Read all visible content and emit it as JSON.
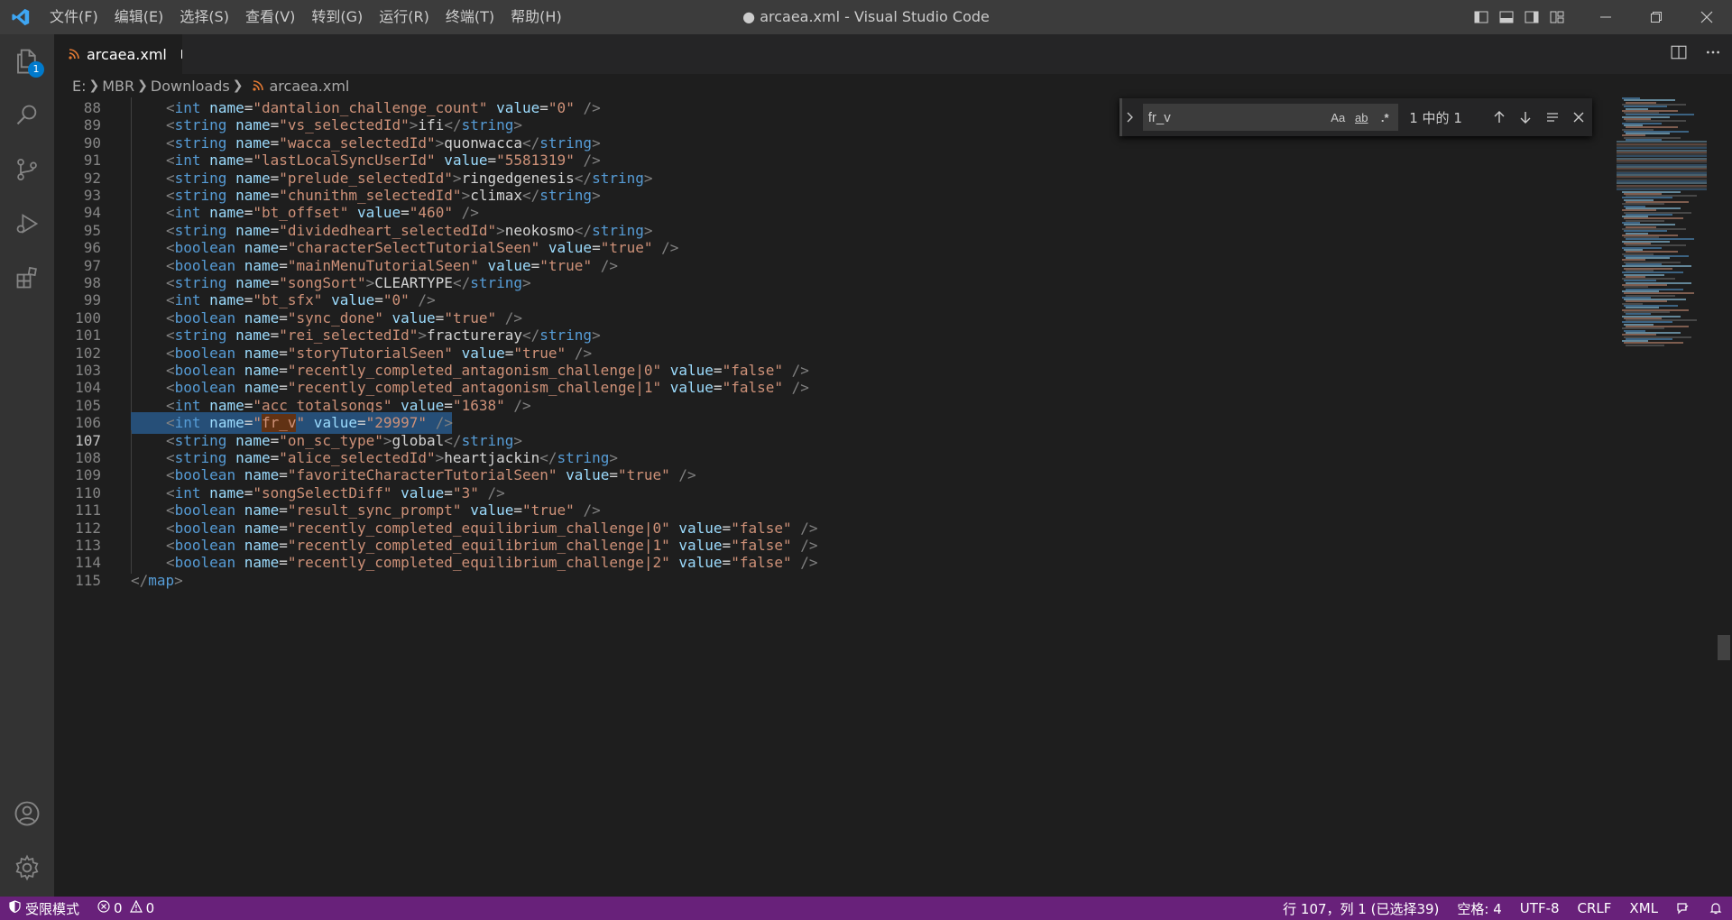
{
  "window": {
    "title": "● arcaea.xml - Visual Studio Code"
  },
  "menu": [
    "文件(F)",
    "编辑(E)",
    "选择(S)",
    "查看(V)",
    "转到(G)",
    "运行(R)",
    "终端(T)",
    "帮助(H)"
  ],
  "activity_bar": {
    "explorer_badge": "1"
  },
  "tab": {
    "label": "arcaea.xml",
    "dirty": true
  },
  "breadcrumb": [
    "E:",
    "MBR",
    "Downloads",
    "arcaea.xml"
  ],
  "find": {
    "query": "fr_v",
    "match_case_label": "Aa",
    "whole_word_label": "ab",
    "regex_label": ".*",
    "count": "1 中的 1"
  },
  "editor": {
    "current_line": 107,
    "selected_line": 106,
    "lines": [
      {
        "n": "88",
        "tag": "int",
        "name": "dantalion_challenge_count",
        "value": "0"
      },
      {
        "n": "89",
        "tag": "string",
        "name": "vs_selectedId",
        "text": "ifi"
      },
      {
        "n": "90",
        "tag": "string",
        "name": "wacca_selectedId",
        "text": "quonwacca"
      },
      {
        "n": "91",
        "tag": "int",
        "name": "lastLocalSyncUserId",
        "value": "5581319"
      },
      {
        "n": "92",
        "tag": "string",
        "name": "prelude_selectedId",
        "text": "ringedgenesis"
      },
      {
        "n": "93",
        "tag": "string",
        "name": "chunithm_selectedId",
        "text": "climax"
      },
      {
        "n": "94",
        "tag": "int",
        "name": "bt_offset",
        "value": "460"
      },
      {
        "n": "95",
        "tag": "string",
        "name": "dividedheart_selectedId",
        "text": "neokosmo"
      },
      {
        "n": "96",
        "tag": "boolean",
        "name": "characterSelectTutorialSeen",
        "value": "true"
      },
      {
        "n": "97",
        "tag": "boolean",
        "name": "mainMenuTutorialSeen",
        "value": "true"
      },
      {
        "n": "98",
        "tag": "string",
        "name": "songSort",
        "text": "CLEARTYPE"
      },
      {
        "n": "99",
        "tag": "int",
        "name": "bt_sfx",
        "value": "0"
      },
      {
        "n": "100",
        "tag": "boolean",
        "name": "sync_done",
        "value": "true"
      },
      {
        "n": "101",
        "tag": "string",
        "name": "rei_selectedId",
        "text": "fractureray"
      },
      {
        "n": "102",
        "tag": "boolean",
        "name": "storyTutorialSeen",
        "value": "true"
      },
      {
        "n": "103",
        "tag": "boolean",
        "name": "recently_completed_antagonism_challenge|0",
        "value": "false"
      },
      {
        "n": "104",
        "tag": "boolean",
        "name": "recently_completed_antagonism_challenge|1",
        "value": "false"
      },
      {
        "n": "105",
        "tag": "int",
        "name": "acc_totalsongs",
        "value": "1638"
      },
      {
        "n": "106",
        "tag": "int",
        "name": "fr_v",
        "value": "29997"
      },
      {
        "n": "107",
        "tag": "string",
        "name": "on_sc_type",
        "text": "global"
      },
      {
        "n": "108",
        "tag": "string",
        "name": "alice_selectedId",
        "text": "heartjackin"
      },
      {
        "n": "109",
        "tag": "boolean",
        "name": "favoriteCharacterTutorialSeen",
        "value": "true"
      },
      {
        "n": "110",
        "tag": "int",
        "name": "songSelectDiff",
        "value": "3"
      },
      {
        "n": "111",
        "tag": "boolean",
        "name": "result_sync_prompt",
        "value": "true"
      },
      {
        "n": "112",
        "tag": "boolean",
        "name": "recently_completed_equilibrium_challenge|0",
        "value": "false"
      },
      {
        "n": "113",
        "tag": "boolean",
        "name": "recently_completed_equilibrium_challenge|1",
        "value": "false"
      },
      {
        "n": "114",
        "tag": "boolean",
        "name": "recently_completed_equilibrium_challenge|2",
        "value": "false"
      },
      {
        "n": "115",
        "close": "map"
      }
    ]
  },
  "status": {
    "restricted": "受限模式",
    "errors": "0",
    "warnings": "0",
    "position": "行 107，列 1 (已选择39)",
    "spaces": "空格: 4",
    "encoding": "UTF-8",
    "eol": "CRLF",
    "language": "XML"
  },
  "colors": {
    "statusbar": "#68217a",
    "accent": "#007acc",
    "tag": "#569cd6",
    "attr_name": "#9cdcfe",
    "attr_value": "#ce9178"
  },
  "icons": [
    "vscode-logo-icon",
    "files-icon",
    "search-icon",
    "source-control-icon",
    "run-debug-icon",
    "extensions-icon",
    "account-icon",
    "gear-icon",
    "split-editor-icon",
    "more-icon",
    "rss-file-icon",
    "shield-icon",
    "error-icon",
    "warning-icon",
    "feedback-icon",
    "bell-icon"
  ]
}
